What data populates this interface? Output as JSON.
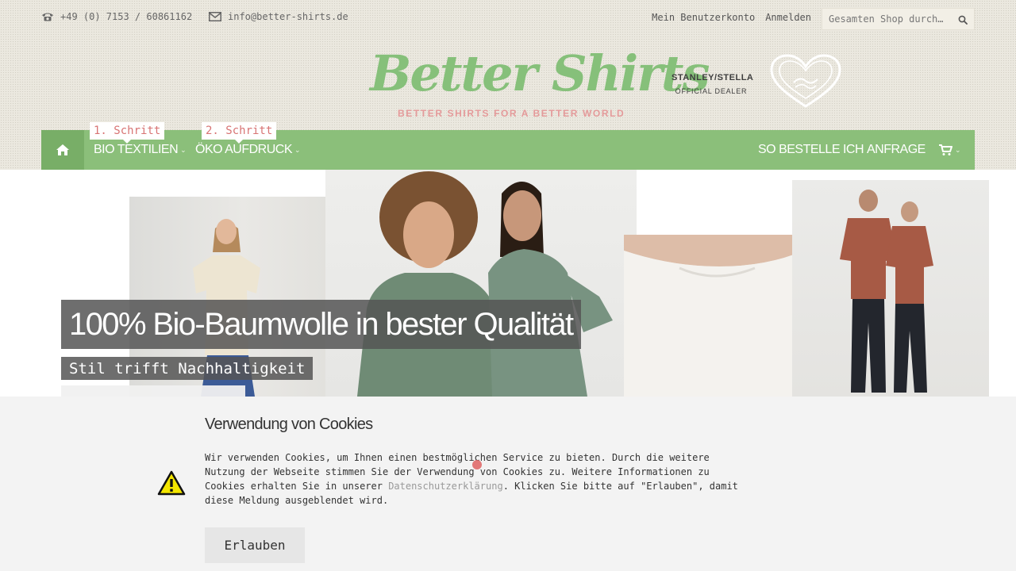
{
  "topbar": {
    "phone": "+49 (0) 7153 / 60861162",
    "email": "info@better-shirts.de",
    "account_label": "Mein Benutzerkonto",
    "login_label": "Anmelden",
    "search_placeholder": "Gesamten Shop durch…"
  },
  "brand": {
    "logo_text": "Better Shirts",
    "tagline": "BETTER SHIRTS FOR A BETTER WORLD",
    "partner_name": "STANLEY/STELLA",
    "partner_badge": "OFFICIAL DEALER",
    "logo_color": "#86c07a",
    "tagline_color": "#e49a9a"
  },
  "nav": {
    "color": "#8bbf7a",
    "home_icon": "home-icon",
    "step1": "1. Schritt",
    "step2": "2. Schritt",
    "item1": "BIO TEXTILIEN",
    "item2": "ÖKO AUFDRUCK",
    "item3": "SO BESTELLE ICH",
    "item4": "ANFRAGE",
    "cart_icon": "cart-icon"
  },
  "hero": {
    "title": "100% Bio-Baumwolle in bester Qualität",
    "subtitle": "Stil trifft Nachhaltigkeit"
  },
  "cookie": {
    "title": "Verwendung von Cookies",
    "text_before_link": "Wir verwenden Cookies, um Ihnen einen bestmöglichen Service zu bieten. Durch die weitere Nutzung der Webseite stimmen Sie der Verwendung von Cookies zu. Weitere Informationen zu Cookies erhalten Sie in unserer ",
    "link_label": "Datenschutzerklärung",
    "text_after_link": ". Klicken Sie bitte auf \"Erlauben\", damit diese Meldung ausgeblendet wird.",
    "button_label": "Erlauben",
    "warning_icon": "warning-icon"
  }
}
